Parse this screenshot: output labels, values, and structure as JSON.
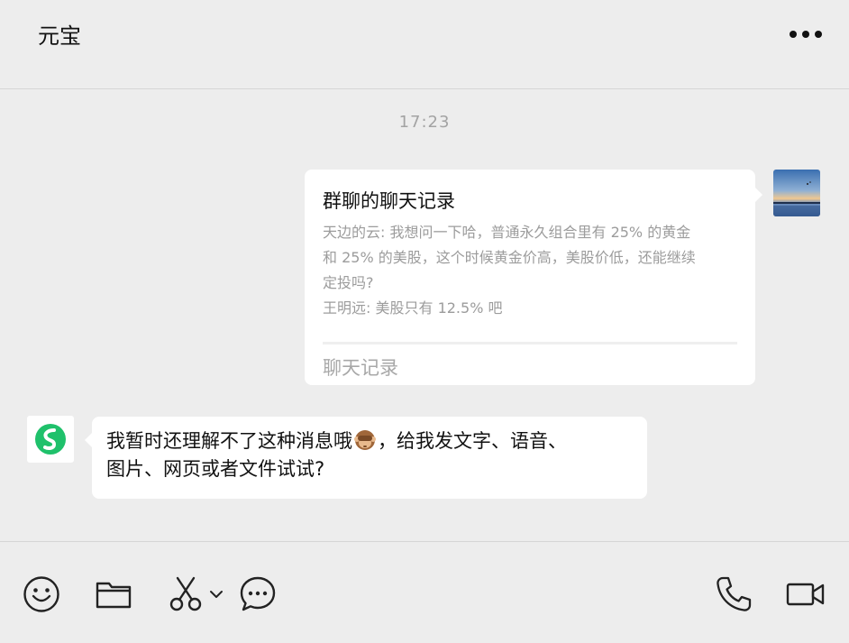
{
  "header": {
    "title": "元宝",
    "more_icon": "more-dots-icon"
  },
  "chat": {
    "timestamp": "17:23",
    "card": {
      "title": "群聊的聊天记录",
      "lines": [
        "天边的云: 我想问一下哈，普通永久组合里有 25% 的黄金",
        "和 25% 的美股，这个时候黄金价高，美股价低，还能继续",
        "定投吗?",
        "王明远: 美股只有 12.5% 吧"
      ],
      "footer": "聊天记录"
    },
    "reply": {
      "line1_before": "我暂时还理解不了这种消息哦",
      "line1_after": "，给我发文字、语音、",
      "line2": "图片、网页或者文件试试?"
    }
  },
  "toolbar": {
    "icons": [
      "emoji-icon",
      "folder-icon",
      "scissors-icon",
      "chat-bubble-icon",
      "phone-icon",
      "video-icon"
    ]
  },
  "colors": {
    "background": "#ededed",
    "bubble": "#ffffff",
    "brand_green": "#1fc16b"
  }
}
